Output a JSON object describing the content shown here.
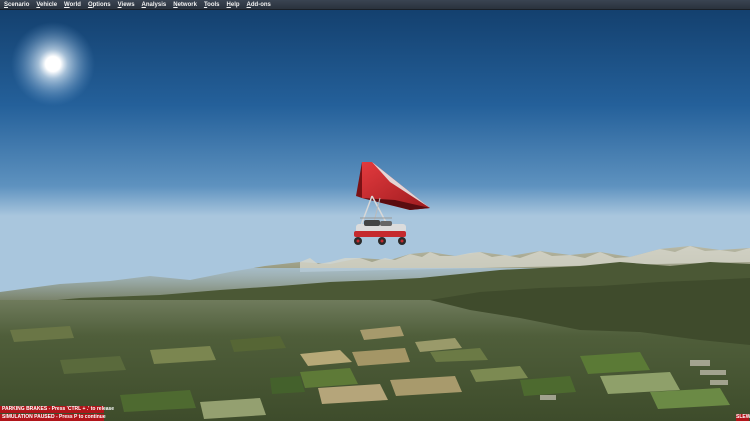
{
  "menu": {
    "items": [
      {
        "label": "Scenario",
        "hotkey": "S",
        "rest": "cenario"
      },
      {
        "label": "Vehicle",
        "hotkey": "V",
        "rest": "ehicle"
      },
      {
        "label": "World",
        "hotkey": "W",
        "rest": "orld"
      },
      {
        "label": "Options",
        "hotkey": "O",
        "rest": "ptions"
      },
      {
        "label": "Views",
        "hotkey": "V",
        "rest": "iews"
      },
      {
        "label": "Analysis",
        "hotkey": "A",
        "rest": "nalysis"
      },
      {
        "label": "Network",
        "hotkey": "N",
        "rest": "etwork"
      },
      {
        "label": "Tools",
        "hotkey": "T",
        "rest": "ools"
      },
      {
        "label": "Help",
        "hotkey": "H",
        "rest": "elp"
      },
      {
        "label": "Add-ons",
        "hotkey": "A",
        "rest": "dd-ons"
      }
    ]
  },
  "status": {
    "parking_brakes": "PARKING BRAKES - Press 'CTRL + .' to release",
    "simulation_paused": "SIMULATION PAUSED - Press P to continue",
    "slew": "SLEW"
  },
  "colors": {
    "sky_top": "#14416e",
    "sky_horizon": "#a9c6dd",
    "status_red": "#b1151a",
    "wing_red": "#c8262b",
    "menubar": "#2e3742"
  },
  "icons": {
    "sun": "sun-glare",
    "aircraft": "ultralight-trike"
  }
}
